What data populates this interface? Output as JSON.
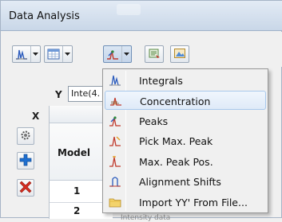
{
  "window": {
    "title": "Data Analysis"
  },
  "y_selector": {
    "label": "Y",
    "value": "Inte(4."
  },
  "x_label": "X",
  "grid": {
    "model_header": "Model",
    "rows": [
      "1",
      "2"
    ]
  },
  "bottom_text": "Intensity    data",
  "menu": {
    "items": [
      {
        "label": "Integrals",
        "icon": "integrals-icon"
      },
      {
        "label": "Concentration",
        "icon": "concentration-icon"
      },
      {
        "label": "Peaks",
        "icon": "peaks-icon"
      },
      {
        "label": "Pick Max. Peak",
        "icon": "pick-max-peak-icon"
      },
      {
        "label": "Max. Peak Pos.",
        "icon": "max-peak-pos-icon"
      },
      {
        "label": "Alignment Shifts",
        "icon": "alignment-shifts-icon"
      },
      {
        "label": "Import YY' From File...",
        "icon": "folder-icon"
      }
    ],
    "highlighted_index": 1
  },
  "colors": {
    "highlight_border": "#a8c8ec",
    "titlebar": "#d7e2ef"
  }
}
